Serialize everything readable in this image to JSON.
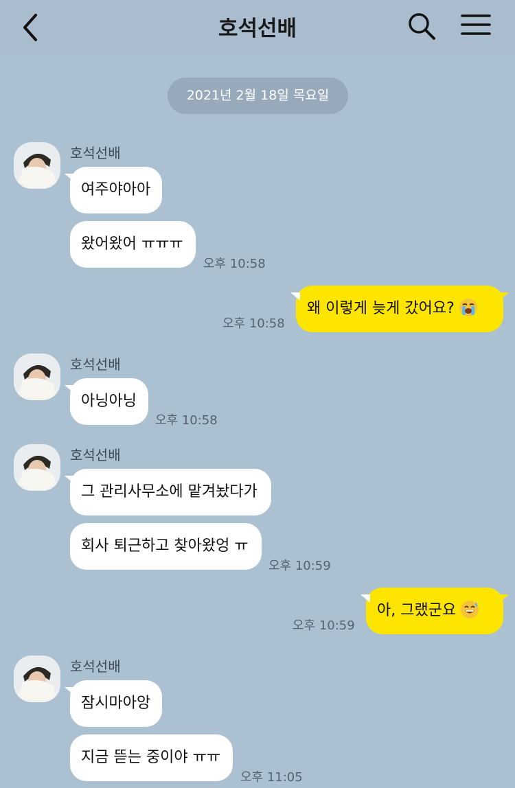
{
  "header": {
    "title": "호석선배"
  },
  "date_divider": "2021년 2월 18일 목요일",
  "messages": [
    {
      "sender": "호석선배",
      "text": "여주야아아"
    },
    {
      "text": "왔어왔어 ㅠㅠㅠ",
      "time": "오후 10:58"
    },
    {
      "mine": true,
      "text": "왜 이렇게 늦게 갔어요?",
      "emoji": "loudly-crying-face",
      "time": "오후 10:58"
    },
    {
      "sender": "호석선배",
      "text": "아닝아닝",
      "time": "오후 10:58"
    },
    {
      "sender": "호석선배",
      "text": "그 관리사무소에 맡겨놨다가"
    },
    {
      "text": "회사 퇴근하고 찾아왔엉 ㅠ",
      "time": "오후 10:59"
    },
    {
      "mine": true,
      "text": "아, 그랬군요",
      "emoji": "grinning-face-with-sweat",
      "time": "오후 10:59"
    },
    {
      "sender": "호석선배",
      "text": "잠시마아앙"
    },
    {
      "text": "지금 뜯는 중이야 ㅠㅠ",
      "time": "오후 11:05"
    }
  ]
}
